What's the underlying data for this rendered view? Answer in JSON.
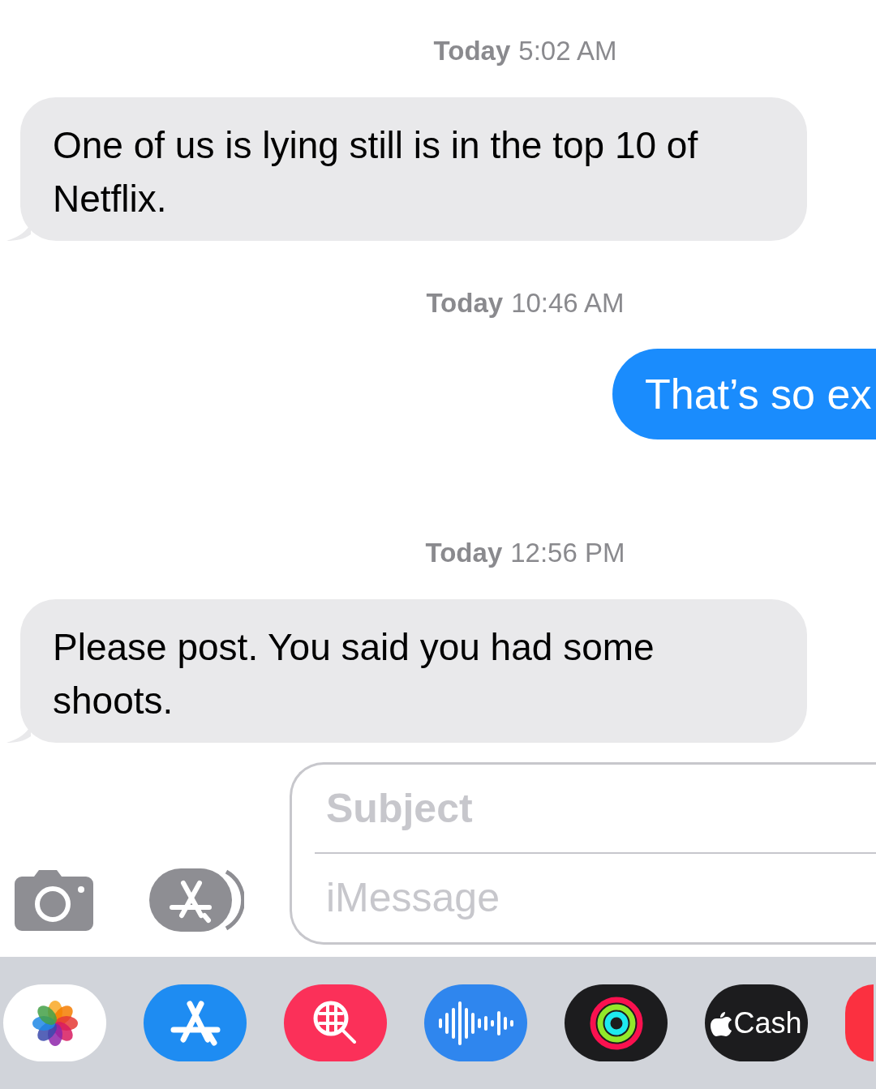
{
  "messages": [
    {
      "kind": "timestamp",
      "day": "Today",
      "time": "5:02 AM"
    },
    {
      "kind": "received",
      "text": "One of us is lying still is in the top 10 of Netflix."
    },
    {
      "kind": "timestamp",
      "day": "Today",
      "time": "10:46 AM"
    },
    {
      "kind": "sent",
      "text": "That’s so ex"
    },
    {
      "kind": "timestamp",
      "day": "Today",
      "time": "12:56 PM"
    },
    {
      "kind": "received",
      "text": "Please post. You said you had some shoots."
    }
  ],
  "compose": {
    "subject_placeholder": "Subject",
    "message_placeholder": "iMessage"
  },
  "apps": [
    {
      "kind": "photos"
    },
    {
      "kind": "appstore"
    },
    {
      "kind": "search"
    },
    {
      "kind": "audio"
    },
    {
      "kind": "activity"
    },
    {
      "kind": "cash",
      "label": "Cash"
    },
    {
      "kind": "partial"
    }
  ]
}
